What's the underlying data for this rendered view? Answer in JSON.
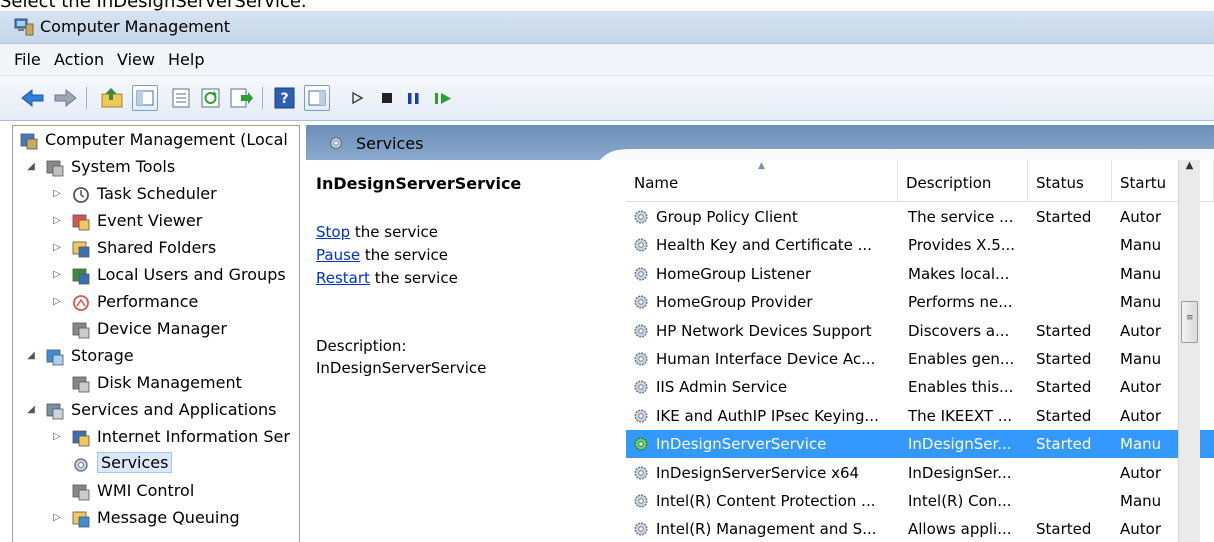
{
  "caption": "Select the InDesignServerService.",
  "window": {
    "title": "Computer Management"
  },
  "menu": [
    "File",
    "Action",
    "View",
    "Help"
  ],
  "toolbar": {
    "icons": [
      "back-arrow-icon",
      "forward-arrow-icon",
      "up-folder-icon",
      "show-hide-tree-icon",
      "properties-icon",
      "refresh-icon",
      "export-list-icon",
      "help-icon",
      "show-hide-action-pane-icon",
      "start-service-icon",
      "stop-service-icon",
      "pause-service-icon",
      "resume-service-icon"
    ]
  },
  "tree": [
    {
      "label": "Computer Management (Local",
      "level": 0,
      "expander": "",
      "icon": "computer-management-icon"
    },
    {
      "label": "System Tools",
      "level": 1,
      "expander": "open",
      "icon": "system-tools-icon"
    },
    {
      "label": "Task Scheduler",
      "level": 2,
      "expander": "closed",
      "icon": "clock-icon"
    },
    {
      "label": "Event Viewer",
      "level": 2,
      "expander": "closed",
      "icon": "event-viewer-icon"
    },
    {
      "label": "Shared Folders",
      "level": 2,
      "expander": "closed",
      "icon": "shared-folders-icon"
    },
    {
      "label": "Local Users and Groups",
      "level": 2,
      "expander": "closed",
      "icon": "users-icon"
    },
    {
      "label": "Performance",
      "level": 2,
      "expander": "closed",
      "icon": "performance-icon"
    },
    {
      "label": "Device Manager",
      "level": 2,
      "expander": "",
      "icon": "device-manager-icon"
    },
    {
      "label": "Storage",
      "level": 1,
      "expander": "open",
      "icon": "storage-icon"
    },
    {
      "label": "Disk Management",
      "level": 2,
      "expander": "",
      "icon": "disk-icon"
    },
    {
      "label": "Services and Applications",
      "level": 1,
      "expander": "open",
      "icon": "services-apps-icon"
    },
    {
      "label": "Internet Information Ser",
      "level": 2,
      "expander": "closed",
      "icon": "iis-icon"
    },
    {
      "label": "Services",
      "level": 2,
      "expander": "",
      "icon": "gear-icon",
      "selected": true
    },
    {
      "label": "WMI Control",
      "level": 2,
      "expander": "",
      "icon": "wmi-icon"
    },
    {
      "label": "Message Queuing",
      "level": 2,
      "expander": "closed",
      "icon": "message-queue-icon"
    }
  ],
  "services_header": {
    "label": "Services"
  },
  "detail": {
    "service_name": "InDesignServerService",
    "actions": [
      {
        "link": "Stop",
        "rest": " the service"
      },
      {
        "link": "Pause",
        "rest": " the service"
      },
      {
        "link": "Restart",
        "rest": " the service"
      }
    ],
    "description_label": "Description:",
    "description_value": "InDesignServerService"
  },
  "grid": {
    "columns": [
      "Name",
      "Description",
      "Status",
      "Startu"
    ],
    "rows": [
      {
        "name": "Group Policy Client",
        "description": "The service ...",
        "status": "Started",
        "startup": "Autor"
      },
      {
        "name": "Health Key and Certificate ...",
        "description": "Provides X.5...",
        "status": "",
        "startup": "Manu"
      },
      {
        "name": "HomeGroup Listener",
        "description": "Makes local...",
        "status": "",
        "startup": "Manu"
      },
      {
        "name": "HomeGroup Provider",
        "description": "Performs ne...",
        "status": "",
        "startup": "Manu"
      },
      {
        "name": "HP Network Devices Support",
        "description": "Discovers a...",
        "status": "Started",
        "startup": "Autor"
      },
      {
        "name": "Human Interface Device Ac...",
        "description": "Enables gen...",
        "status": "Started",
        "startup": "Manu"
      },
      {
        "name": "IIS Admin Service",
        "description": "Enables this...",
        "status": "Started",
        "startup": "Autor"
      },
      {
        "name": "IKE and AuthIP IPsec Keying...",
        "description": "The IKEEXT ...",
        "status": "Started",
        "startup": "Autor"
      },
      {
        "name": "InDesignServerService",
        "description": "InDesignSer...",
        "status": "Started",
        "startup": "Manu",
        "selected": true
      },
      {
        "name": "InDesignServerService x64",
        "description": "InDesignSer...",
        "status": "",
        "startup": "Autor"
      },
      {
        "name": "Intel(R) Content Protection ...",
        "description": "Intel(R) Con...",
        "status": "",
        "startup": "Manu"
      },
      {
        "name": "Intel(R) Management and S...",
        "description": "Allows appli...",
        "status": "Started",
        "startup": "Autor"
      }
    ]
  },
  "colors": {
    "selection": "#3399ff",
    "header_band": "#7a9cc4",
    "link": "#0033cc"
  }
}
